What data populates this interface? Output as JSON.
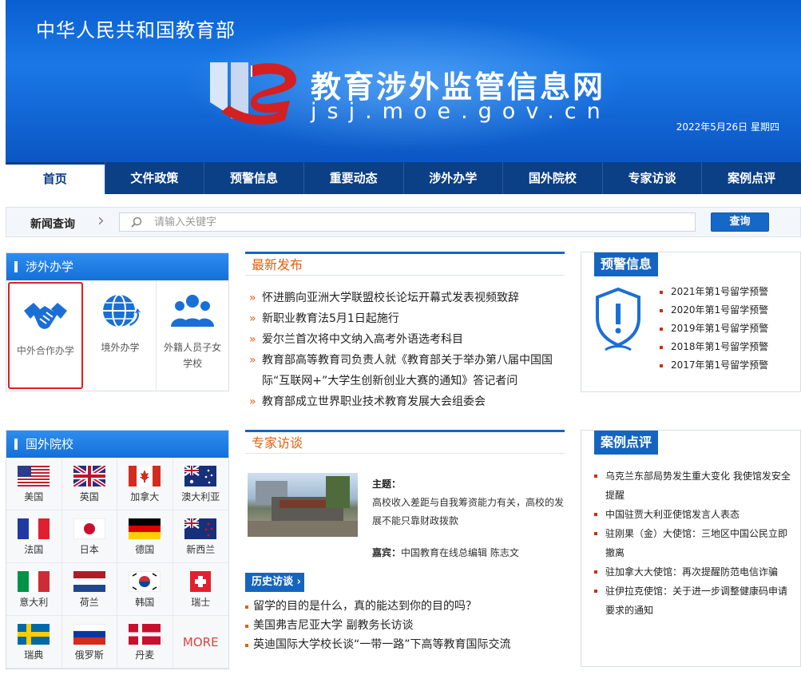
{
  "header": {
    "ministry": "中华人民共和国教育部",
    "site_name": "教育涉外监管信息网",
    "site_url": "jsj.moe.gov.cn",
    "date": "2022年5月26日  星期四"
  },
  "nav": {
    "tabs": [
      {
        "label": "首页",
        "active": true
      },
      {
        "label": "文件政策"
      },
      {
        "label": "预警信息"
      },
      {
        "label": "重要动态"
      },
      {
        "label": "涉外办学"
      },
      {
        "label": "国外院校"
      },
      {
        "label": "专家访谈"
      },
      {
        "label": "案例点评"
      }
    ]
  },
  "search": {
    "label": "新闻查询",
    "placeholder": "请输入关键字",
    "button": "查询"
  },
  "abroad": {
    "title": "涉外办学",
    "items": [
      {
        "label": "中外合作办学",
        "icon": "handshake-icon",
        "selected": true
      },
      {
        "label": "境外办学",
        "icon": "globe-icon"
      },
      {
        "label": "外籍人员子女学校",
        "icon": "people-icon"
      }
    ]
  },
  "schools": {
    "title": "国外院校",
    "countries": [
      "美国",
      "英国",
      "加拿大",
      "澳大利亚",
      "法国",
      "日本",
      "德国",
      "新西兰",
      "意大利",
      "荷兰",
      "韩国",
      "瑞士",
      "瑞典",
      "俄罗斯",
      "丹麦"
    ],
    "more": "MORE"
  },
  "latest": {
    "title": "最新发布",
    "items": [
      "怀进鹏向亚洲大学联盟校长论坛开幕式发表视频致辞",
      "新职业教育法5月1日起施行",
      "爱尔兰首次将中文纳入高考外语选考科目",
      "教育部高等教育司负责人就《教育部关于举办第八届中国国际“互联网+”大学生创新创业大赛的通知》答记者问",
      "教育部成立世界职业技术教育发展大会组委会"
    ]
  },
  "expert": {
    "title": "专家访谈",
    "topic_label": "主题：",
    "topic": "高校收入差距与自我筹资能力有关，高校的发展不能只靠财政拨款",
    "guest_label": "嘉宾：",
    "guest": "中国教育在线总编辑 陈志文",
    "history_label": "历史访谈",
    "history": [
      "留学的目的是什么，真的能达到你的目的吗？",
      "美国弗吉尼亚大学 副教务长访谈",
      "英迪国际大学校长谈“一带一路”下高等教育国际交流"
    ]
  },
  "warnings": {
    "title": "预警信息",
    "items": [
      "2021年第1号留学预警",
      "2020年第1号留学预警",
      "2019年第1号留学预警",
      "2018年第1号留学预警",
      "2017年第1号留学预警"
    ]
  },
  "cases": {
    "title": "案例点评",
    "items": [
      "乌克兰东部局势发生重大变化 我使馆发安全提醒",
      "中国驻贾大利亚使馆发言人表态",
      "驻刚果（金）大使馆：三地区中国公民立即撤离",
      "驻加拿大大使馆：再次提醒防范电信诈骗",
      "驻伊拉克使馆：关于进一步调整健康码申请要求的通知"
    ]
  },
  "colors": {
    "primary": "#1565c0",
    "nav": "#0b3f86",
    "accent": "#e06010",
    "selected_border": "#e02020"
  }
}
